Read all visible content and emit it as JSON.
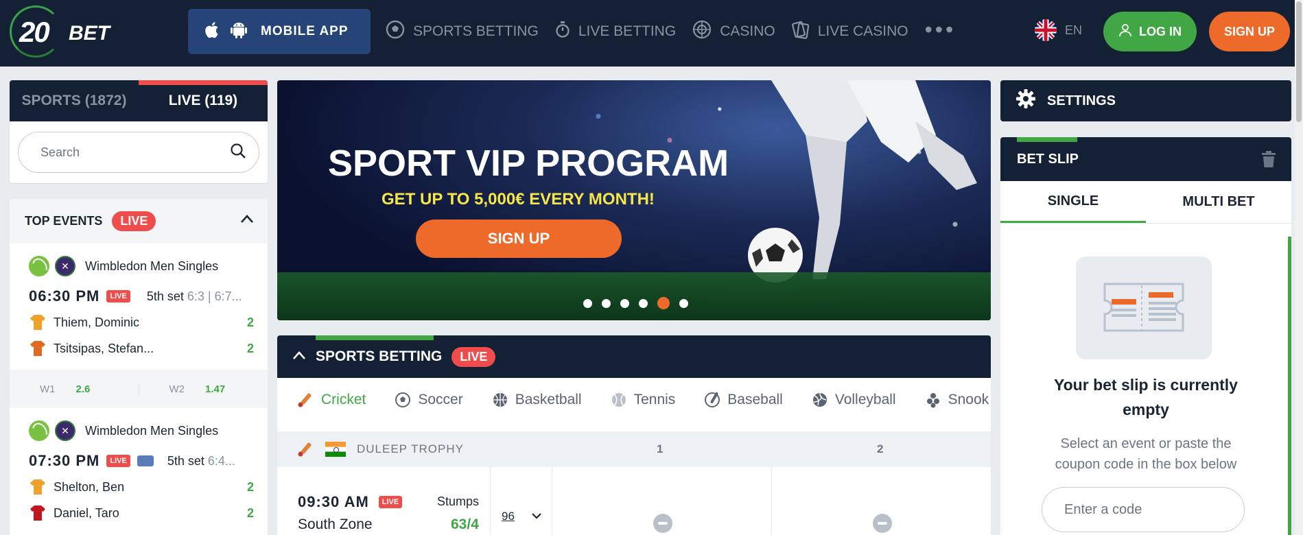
{
  "header": {
    "logo_number": "20",
    "logo_text": "BET",
    "mobile_app_label": "MOBILE APP",
    "nav": [
      {
        "label": "SPORTS BETTING",
        "icon": "soccer-ball-icon"
      },
      {
        "label": "LIVE BETTING",
        "icon": "stopwatch-icon"
      },
      {
        "label": "CASINO",
        "icon": "roulette-icon"
      },
      {
        "label": "LIVE CASINO",
        "icon": "cards-icon"
      }
    ],
    "more_label": "•••",
    "language": "EN",
    "login_label": "LOG IN",
    "signup_label": "SIGN UP"
  },
  "left": {
    "tab_sports": "SPORTS (1872)",
    "tab_live": "LIVE (119)",
    "search_placeholder": "Search",
    "top_events_title": "TOP EVENTS",
    "live_badge": "LIVE",
    "events": [
      {
        "competition": "Wimbledon Men Singles",
        "time": "06:30 PM",
        "live": "LIVE",
        "set": "5th set",
        "score": "6:3 | 6:7...",
        "players": [
          {
            "name": "Thiem, Dominic",
            "points": "2"
          },
          {
            "name": "Tsitsipas, Stefan...",
            "points": "2"
          }
        ],
        "odds": [
          {
            "label": "W1",
            "value": "2.6"
          },
          {
            "label": "W2",
            "value": "1.47"
          }
        ]
      },
      {
        "competition": "Wimbledon Men Singles",
        "time": "07:30 PM",
        "live": "LIVE",
        "set": "5th set",
        "score": "6:4...",
        "players": [
          {
            "name": "Shelton, Ben",
            "points": "2"
          },
          {
            "name": "Daniel, Taro",
            "points": "2"
          }
        ]
      }
    ]
  },
  "banner": {
    "title": "SPORT VIP PROGRAM",
    "subtitle": "GET UP TO 5,000€ EVERY MONTH!",
    "button": "SIGN UP",
    "slides": 6,
    "active_slide": 5
  },
  "sports_betting": {
    "title": "SPORTS BETTING",
    "live_badge": "LIVE",
    "tabs": [
      "Cricket",
      "Soccer",
      "Basketball",
      "Tennis",
      "Baseball",
      "Volleyball",
      "Snook"
    ],
    "active_tab": "Cricket",
    "league": "DULEEP TROPHY",
    "col1": "1",
    "col2": "2",
    "match": {
      "time": "09:30 AM",
      "live": "LIVE",
      "status": "Stumps",
      "team": "South Zone",
      "score": "63/4",
      "more_markets": "96"
    }
  },
  "right": {
    "settings_label": "SETTINGS",
    "betslip_title": "BET SLIP",
    "tab_single": "SINGLE",
    "tab_multi": "MULTI BET",
    "empty_title": "Your bet slip is currently empty",
    "empty_hint": "Select an event or paste the coupon code in the box below",
    "code_placeholder": "Enter a code"
  },
  "colors": {
    "navy": "#142134",
    "green": "#41a744",
    "orange": "#ee6a2b",
    "red": "#ef4c4c",
    "app_blue": "#264478",
    "yellow": "#f6e64a"
  }
}
